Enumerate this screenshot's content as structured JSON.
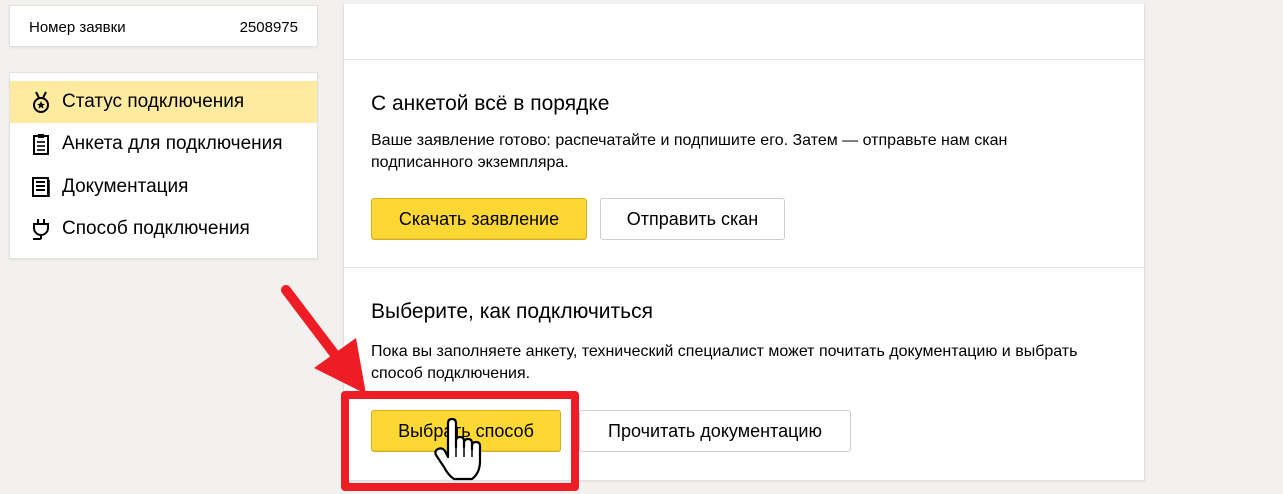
{
  "order": {
    "label": "Номер заявки",
    "number": "2508975"
  },
  "nav": {
    "items": [
      {
        "label": "Статус подключения",
        "icon": "medal-icon",
        "active": true
      },
      {
        "label": "Анкета для подключения",
        "icon": "clipboard-icon",
        "active": false
      },
      {
        "label": "Документация",
        "icon": "document-icon",
        "active": false
      },
      {
        "label": "Способ подключения",
        "icon": "plug-icon",
        "active": false
      }
    ]
  },
  "sections": [
    {
      "title": "С анкетой всё в порядке",
      "text": "Ваше заявление готово: распечатайте и подпишите его. Затем — отправьте нам скан подписанного экземпляра.",
      "primary_button": "Скачать заявление",
      "secondary_button": "Отправить скан"
    },
    {
      "title": "Выберите, как подключиться",
      "text": "Пока вы заполняете анкету, технический специалист может почитать документацию и выбрать способ подключения.",
      "primary_button": "Выбрать способ",
      "secondary_button": "Прочитать документацию"
    }
  ],
  "colors": {
    "accent_yellow": "#fdd835",
    "active_nav": "#ffeba0",
    "annotation_red": "#ee1c24",
    "background": "#f2f1ef"
  }
}
